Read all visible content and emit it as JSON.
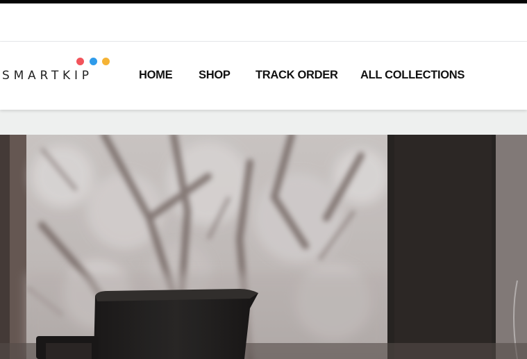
{
  "header": {
    "logo": {
      "text": "SMARTKIP",
      "dot_colors": [
        "#f2545b",
        "#2f9bea",
        "#f5b335"
      ]
    },
    "nav": {
      "home": "HOME",
      "shop": "SHOP",
      "track_order": "TRACK ORDER",
      "all_collections": "ALL COLLECTIONS"
    }
  },
  "hero": {
    "image": "coffee-pot-by-snowy-window"
  },
  "colors": {
    "top_bar": "#050505",
    "band": "#eef0ef",
    "nav_text": "#111111"
  }
}
